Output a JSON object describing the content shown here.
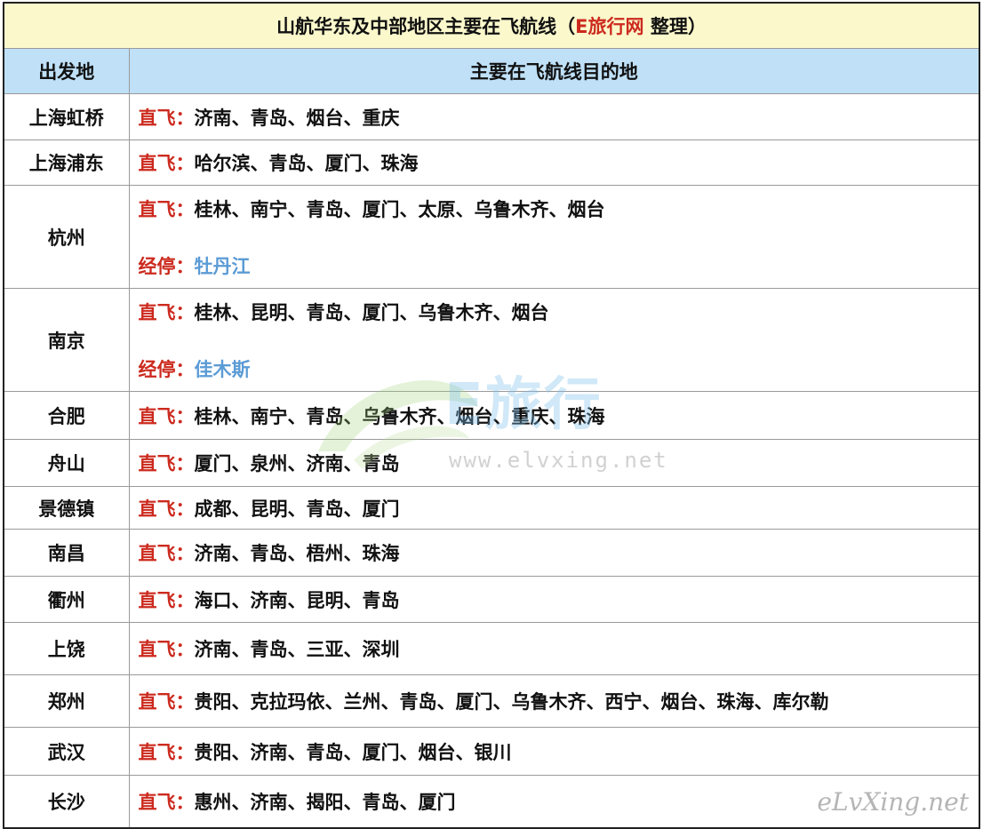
{
  "title": {
    "prefix": "山航华东及中部地区主要在飞航线（",
    "brand": "E旅行网",
    "suffix": " 整理）"
  },
  "headers": {
    "origin": "出发地",
    "destinations": "主要在飞航线目的地"
  },
  "rows": [
    {
      "city": "上海虹桥",
      "direct_label": "直飞：",
      "direct": "济南、青岛、烟台、重庆"
    },
    {
      "city": "上海浦东",
      "direct_label": "直飞：",
      "direct": "哈尔滨、青岛、厦门、珠海"
    },
    {
      "city": "杭州",
      "direct_label": "直飞：",
      "direct": "桂林、南宁、青岛、厦门、太原、乌鲁木齐、烟台",
      "stop_label": "经停：",
      "stop": "牡丹江"
    },
    {
      "city": "南京",
      "direct_label": "直飞：",
      "direct": "桂林、昆明、青岛、厦门、乌鲁木齐、烟台",
      "stop_label": "经停：",
      "stop": "佳木斯"
    },
    {
      "city": "合肥",
      "direct_label": "直飞：",
      "direct": "桂林、南宁、青岛、乌鲁木齐、烟台、重庆、珠海"
    },
    {
      "city": "舟山",
      "direct_label": "直飞：",
      "direct": "厦门、泉州、济南、青岛"
    },
    {
      "city": "景德镇",
      "direct_label": "直飞：",
      "direct": "成都、昆明、青岛、厦门"
    },
    {
      "city": "南昌",
      "direct_label": "直飞：",
      "direct": "济南、青岛、梧州、珠海"
    },
    {
      "city": "衢州",
      "direct_label": "直飞：",
      "direct": "海口、济南、昆明、青岛"
    },
    {
      "city": "上饶",
      "direct_label": "直飞：",
      "direct": "济南、青岛、三亚、深圳"
    },
    {
      "city": "郑州",
      "direct_label": "直飞：",
      "direct": "贵阳、克拉玛依、兰州、青岛、厦门、乌鲁木齐、西宁、烟台、珠海、库尔勒"
    },
    {
      "city": "武汉",
      "direct_label": "直飞：",
      "direct": "贵阳、济南、青岛、厦门、烟台、银川"
    },
    {
      "city": "长沙",
      "direct_label": "直飞：",
      "direct": "惠州、济南、揭阳、青岛、厦门"
    }
  ],
  "watermark": {
    "logo_text": "E旅行",
    "url": "www.elvxing.net",
    "corner": "eLvXing.net"
  }
}
